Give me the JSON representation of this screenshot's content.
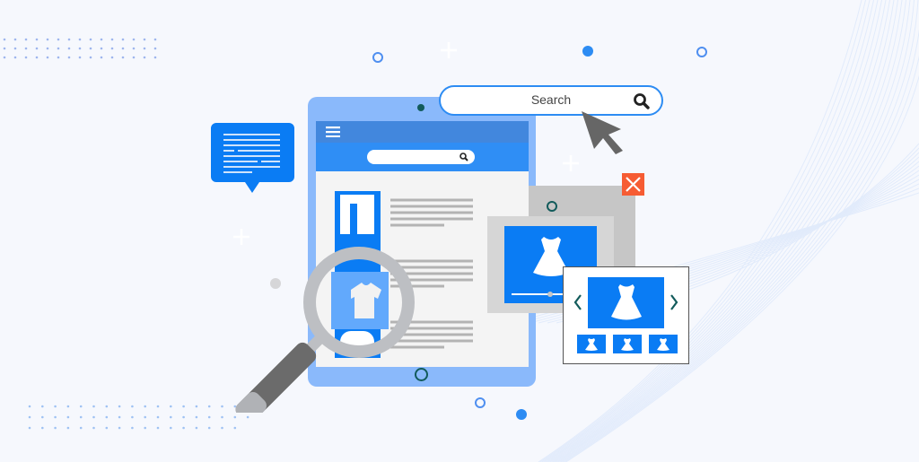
{
  "illustration": {
    "subject": "product image search on a tablet",
    "colors": {
      "background": "#f6f8fd",
      "primary_blue": "#0a7cf4",
      "light_blue": "#8ab9fb",
      "header_blue": "#4287dd",
      "sub_header_blue": "#2f8ef5",
      "content_gray": "#f4f4f4",
      "line_gray": "#b3b3b3",
      "magnifier_gray": "#bdbfc3",
      "handle_dark": "#6b6b6b",
      "close_orange": "#f65c33",
      "teal_dot": "#125b5b"
    }
  },
  "search_bar": {
    "placeholder": "Search",
    "icon": "search-icon"
  },
  "tablet": {
    "menu_icon": "hamburger-menu-icon",
    "inner_search_icon": "search-icon",
    "articles": 3
  },
  "carousel": {
    "prev_icon": "chevron-left-icon",
    "next_icon": "chevron-right-icon",
    "thumbnails": 3
  },
  "popup": {
    "close_icon": "close-icon"
  }
}
